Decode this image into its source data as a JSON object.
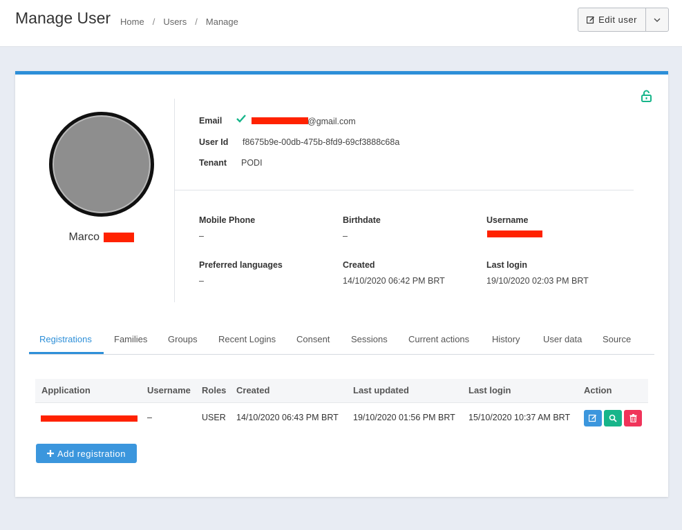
{
  "header": {
    "title": "Manage User",
    "breadcrumb": [
      "Home",
      "Users",
      "Manage"
    ],
    "separator": "/",
    "edit_label": "Edit user"
  },
  "profile": {
    "first_name": "Marco"
  },
  "info": {
    "email_label": "Email",
    "email_suffix": "@gmail.com",
    "user_id_label": "User Id",
    "user_id": "f8675b9e-00db-475b-8fd9-69cf3888c68a",
    "tenant_label": "Tenant",
    "tenant": "PODI"
  },
  "details": {
    "mobile_label": "Mobile Phone",
    "mobile_value": "–",
    "birthdate_label": "Birthdate",
    "birthdate_value": "–",
    "username_label": "Username",
    "languages_label": "Preferred languages",
    "languages_value": "–",
    "created_label": "Created",
    "created_value": "14/10/2020 06:42 PM BRT",
    "last_login_label": "Last login",
    "last_login_value": "19/10/2020 02:03 PM BRT"
  },
  "tabs": [
    "Registrations",
    "Families",
    "Groups",
    "Recent Logins",
    "Consent",
    "Sessions",
    "Current actions",
    "History",
    "User data",
    "Source"
  ],
  "registrations": {
    "columns": [
      "Application",
      "Username",
      "Roles",
      "Created",
      "Last updated",
      "Last login",
      "Action"
    ],
    "rows": [
      {
        "username": "–",
        "roles": "USER",
        "created": "14/10/2020 06:43 PM BRT",
        "last_updated": "19/10/2020 01:56 PM BRT",
        "last_login": "15/10/2020 10:37 AM BRT"
      }
    ],
    "add_label": "Add registration"
  },
  "colors": {
    "primary": "#2d8fd8",
    "success": "#17b58a",
    "danger": "#f0345a",
    "redaction": "#ff2200"
  },
  "icons": [
    "edit-icon",
    "chevron-down-icon",
    "unlock-icon",
    "check-icon",
    "search-icon",
    "trash-icon",
    "plus-icon"
  ]
}
